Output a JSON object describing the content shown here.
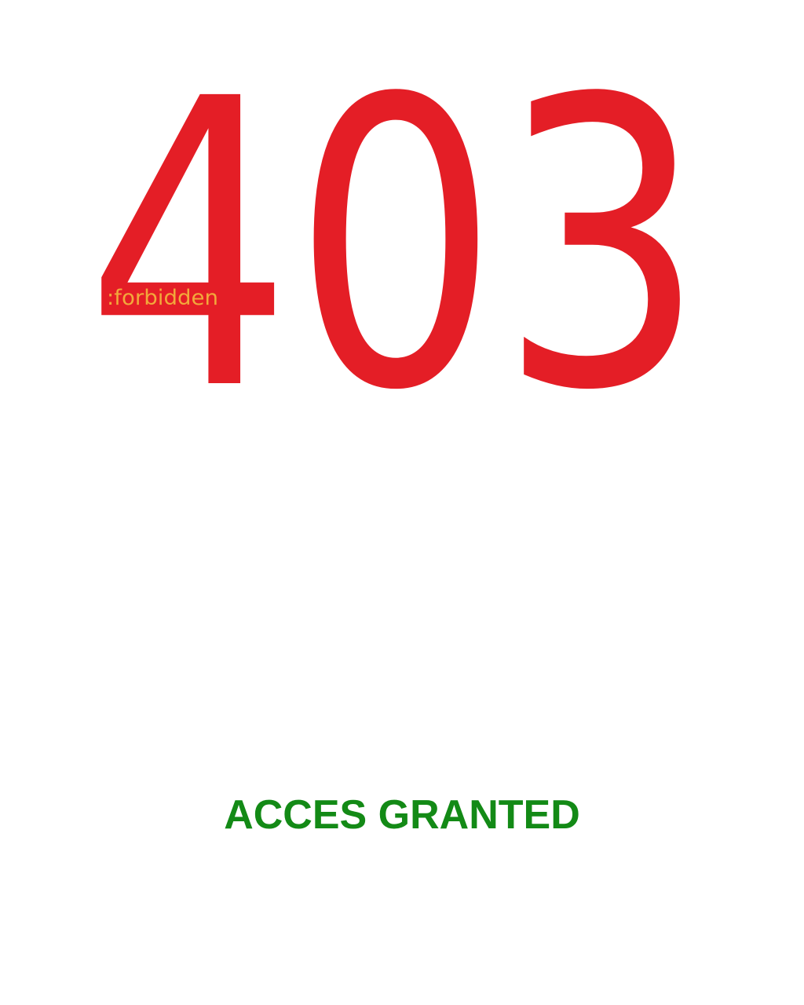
{
  "error_code": "403",
  "error_label": ":forbidden",
  "status_message": "ACCES GRANTED",
  "colors": {
    "code": "#e41e26",
    "label": "#f2a93b",
    "status": "#138a16",
    "background": "#ffffff"
  }
}
